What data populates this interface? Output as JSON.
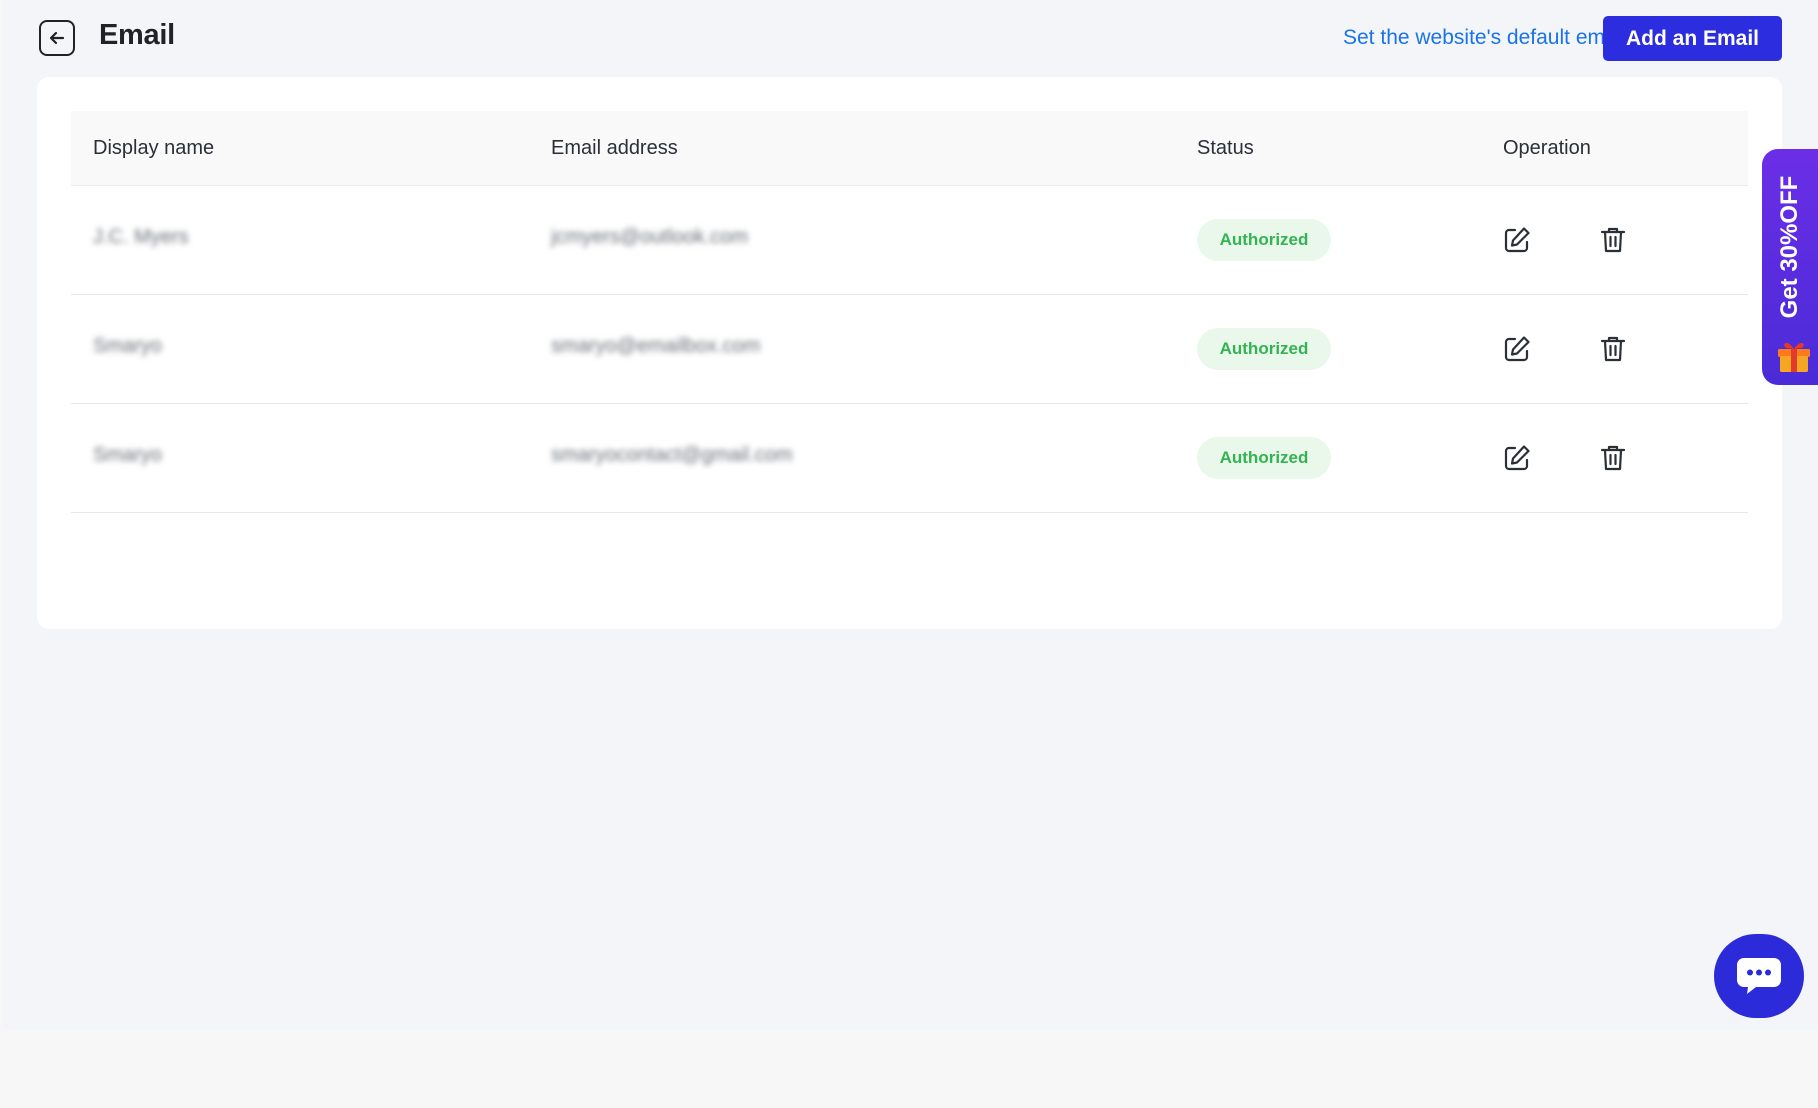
{
  "header": {
    "title": "Email",
    "default_link": "Set the website's default email",
    "add_button": "Add an Email"
  },
  "table": {
    "columns": [
      "Display name",
      "Email address",
      "Status",
      "Operation"
    ],
    "rows": [
      {
        "display_name": "J.C. Myers",
        "email": "jcmyers@outlook.com",
        "status": "Authorized"
      },
      {
        "display_name": "Smaryo",
        "email": "smaryo@emailbox.com",
        "status": "Authorized"
      },
      {
        "display_name": "Smaryo",
        "email": "smaryocontact@gmail.com",
        "status": "Authorized"
      }
    ]
  },
  "promo": {
    "text": "Get 30%OFF"
  },
  "colors": {
    "primary": "#2d2de0",
    "link": "#1a73e8",
    "badge_bg": "#eaf8ec",
    "badge_text": "#34b352",
    "promo_bg": "#5a2de0"
  },
  "icons": {
    "back": "arrow-left-icon",
    "edit": "edit-icon",
    "delete": "trash-icon",
    "gift": "gift-icon",
    "chat": "chat-bubble-icon"
  }
}
